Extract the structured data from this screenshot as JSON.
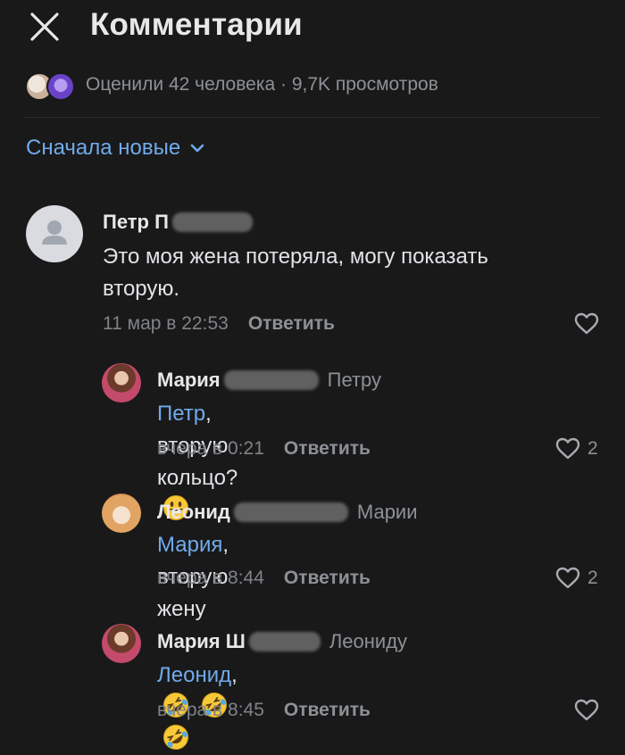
{
  "header": {
    "title": "Комментарии"
  },
  "reactions": {
    "text": "Оценили 42 человека · 9,7K просмотров"
  },
  "sort": {
    "label": "Сначала новые"
  },
  "comments": [
    {
      "author": "Петр П",
      "text": "Это моя жена потеряла, могу показать вторую.",
      "text_line1": "Это моя жена потеряла, могу показать",
      "text_line2": "вторую.",
      "time": "11 мар в 22:53",
      "reply_label": "Ответить",
      "likes": ""
    },
    {
      "author": "Мария",
      "reply_to": "Петру",
      "mention": "Петр",
      "text": ", вторую кольцо?",
      "emoji": "smiling-face-emoji",
      "time": "вчера в 0:21",
      "reply_label": "Ответить",
      "likes": "2"
    },
    {
      "author": "Леонид",
      "reply_to": "Марии",
      "mention": "Мария",
      "text": ", вторую жену",
      "time": "вчера в 8:44",
      "reply_label": "Ответить",
      "likes": "2"
    },
    {
      "author": "Мария Ш",
      "reply_to": "Леониду",
      "mention": "Леонид",
      "text": ",",
      "emoji": "rolling-on-floor-laughing-emoji",
      "time": "вчера в 8:45",
      "reply_label": "Ответить",
      "likes": ""
    }
  ],
  "colors": {
    "background": "#19191a",
    "accent": "#71aaeb",
    "secondary_text": "#8d9196"
  }
}
